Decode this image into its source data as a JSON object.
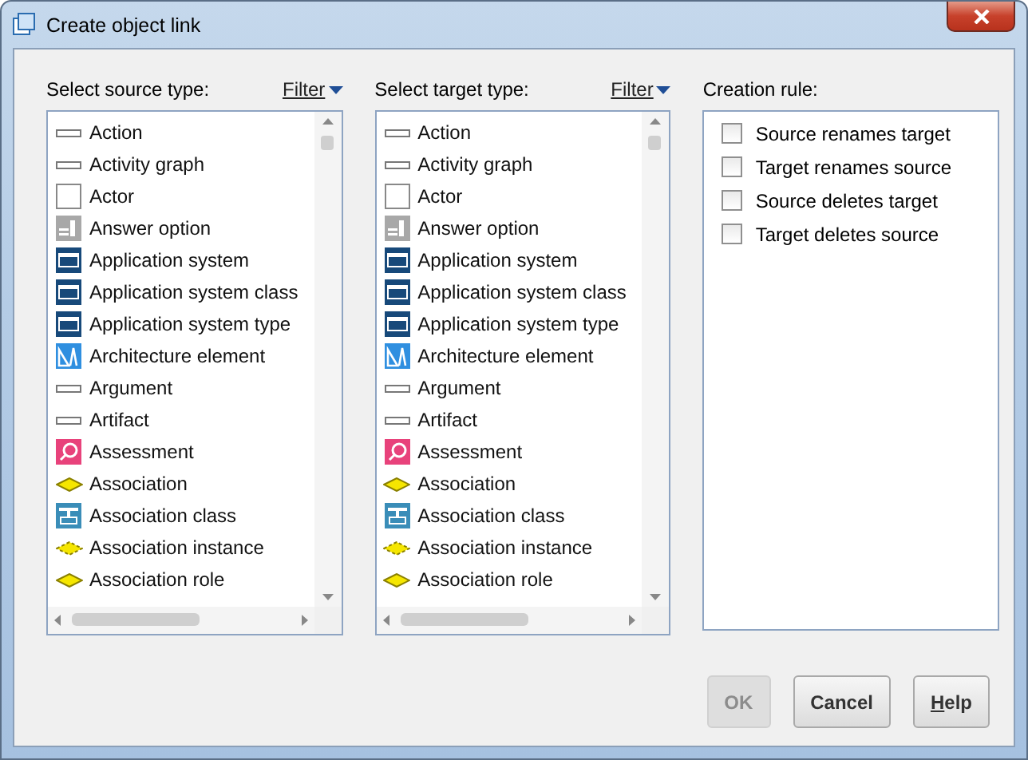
{
  "window": {
    "title": "Create object link"
  },
  "source": {
    "label": "Select source type:",
    "filter": "Filter",
    "items": [
      {
        "label": "Action",
        "kind": "bar"
      },
      {
        "label": "Activity graph",
        "kind": "bar"
      },
      {
        "label": "Actor",
        "kind": "square"
      },
      {
        "label": "Answer option",
        "kind": "answer"
      },
      {
        "label": "Application system",
        "kind": "appsys"
      },
      {
        "label": "Application system class",
        "kind": "appsys"
      },
      {
        "label": "Application system type",
        "kind": "appsys"
      },
      {
        "label": "Architecture element",
        "kind": "architecture"
      },
      {
        "label": "Argument",
        "kind": "bar"
      },
      {
        "label": "Artifact",
        "kind": "bar"
      },
      {
        "label": "Assessment",
        "kind": "assessment"
      },
      {
        "label": "Association",
        "kind": "diamond"
      },
      {
        "label": "Association class",
        "kind": "assocclass"
      },
      {
        "label": "Association instance",
        "kind": "dasheddiamond"
      },
      {
        "label": "Association role",
        "kind": "diamond"
      }
    ]
  },
  "target": {
    "label": "Select target type:",
    "filter": "Filter",
    "items": [
      {
        "label": "Action",
        "kind": "bar"
      },
      {
        "label": "Activity graph",
        "kind": "bar"
      },
      {
        "label": "Actor",
        "kind": "square"
      },
      {
        "label": "Answer option",
        "kind": "answer"
      },
      {
        "label": "Application system",
        "kind": "appsys"
      },
      {
        "label": "Application system class",
        "kind": "appsys"
      },
      {
        "label": "Application system type",
        "kind": "appsys"
      },
      {
        "label": "Architecture element",
        "kind": "architecture"
      },
      {
        "label": "Argument",
        "kind": "bar"
      },
      {
        "label": "Artifact",
        "kind": "bar"
      },
      {
        "label": "Assessment",
        "kind": "assessment"
      },
      {
        "label": "Association",
        "kind": "diamond"
      },
      {
        "label": "Association class",
        "kind": "assocclass"
      },
      {
        "label": "Association instance",
        "kind": "dasheddiamond"
      },
      {
        "label": "Association role",
        "kind": "diamond"
      }
    ]
  },
  "creation_rule": {
    "label": "Creation rule:",
    "options": [
      {
        "label": "Source renames target",
        "checked": false
      },
      {
        "label": "Target renames source",
        "checked": false
      },
      {
        "label": "Source deletes target",
        "checked": false
      },
      {
        "label": "Target deletes source",
        "checked": false
      }
    ]
  },
  "buttons": [
    {
      "label": "OK",
      "disabled": true,
      "mnemonic_first": false
    },
    {
      "label": "Cancel",
      "disabled": false,
      "mnemonic_first": false
    },
    {
      "label": "Help",
      "disabled": false,
      "mnemonic_first": true
    }
  ]
}
